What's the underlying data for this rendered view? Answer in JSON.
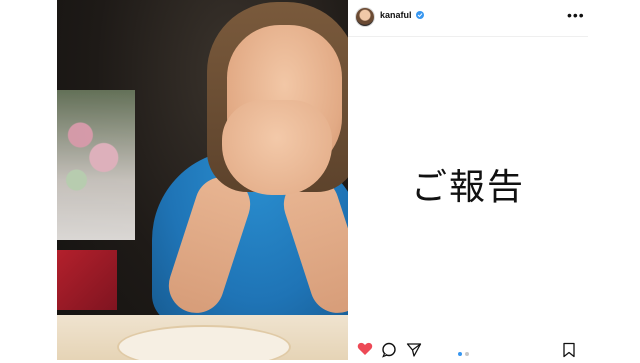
{
  "post": {
    "username": "kanaful",
    "caption_text": "ご報告",
    "more_label": "•••"
  },
  "colors": {
    "like_red": "#ed4956",
    "verified_blue": "#3897f0",
    "dot_active": "#3897f0",
    "dot_inactive": "#c7c7c7"
  },
  "icons": {
    "verified": "verified-badge-icon",
    "more": "more-options-icon",
    "like": "heart-icon",
    "comment": "comment-icon",
    "share": "send-icon",
    "save": "bookmark-icon"
  },
  "carousel": {
    "count": 2,
    "active_index": 0
  }
}
